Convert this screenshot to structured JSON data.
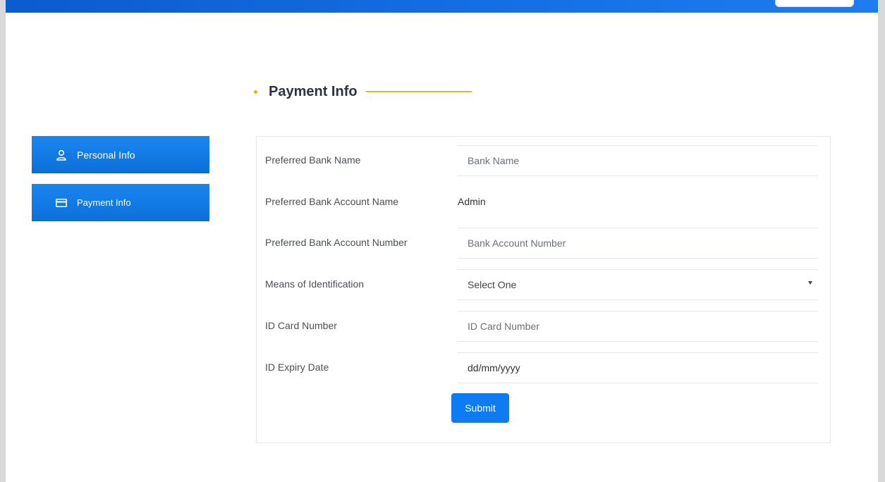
{
  "sidebar": {
    "items": [
      {
        "label": "Personal Info",
        "icon": "user-icon"
      },
      {
        "label": "Payment Info",
        "icon": "card-icon"
      }
    ]
  },
  "section": {
    "title": "Payment Info"
  },
  "form": {
    "bank_name": {
      "label": "Preferred Bank Name",
      "placeholder": "Bank Name"
    },
    "account_name": {
      "label": "Preferred Bank Account Name",
      "value": "Admin"
    },
    "account_number": {
      "label": "Preferred Bank Account Number",
      "placeholder": "Bank Account Number"
    },
    "id_means": {
      "label": "Means of Identification",
      "selected": "Select One"
    },
    "id_number": {
      "label": "ID Card Number",
      "placeholder": "ID Card Number"
    },
    "id_expiry": {
      "label": "ID Expiry Date",
      "value": "dd/mm/yyyy"
    },
    "submit_label": "Submit"
  },
  "colors": {
    "primary": "#0d7cf2",
    "accent": "#e8b13a",
    "topbar": "#1570e6"
  }
}
